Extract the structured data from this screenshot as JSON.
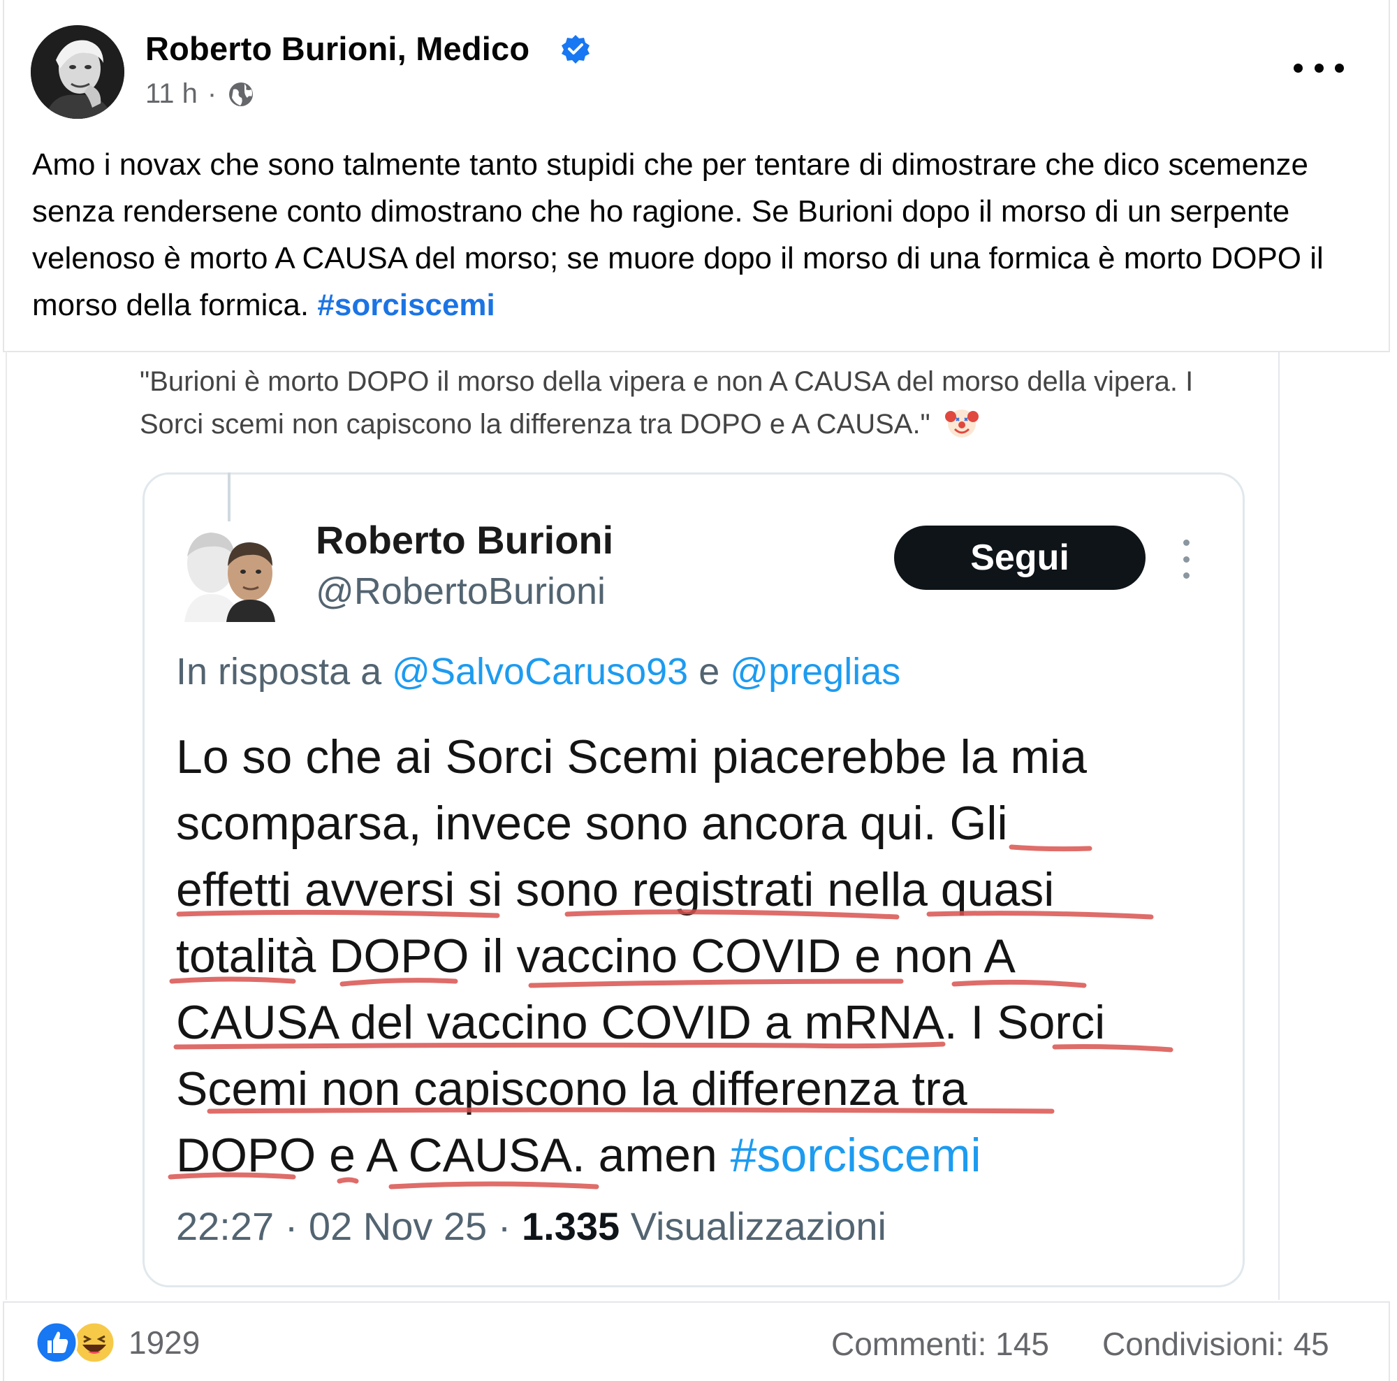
{
  "post": {
    "author": "Roberto Burioni, Medico",
    "time": "11 h",
    "separator": "·",
    "text": "Amo i novax che sono talmente tanto stupidi che per tentare di dimostrare che dico scemenze senza rendersene conto dimostrano che ho ragione. Se Burioni dopo il morso di un serpente velenoso è morto A CAUSA del morso; se muore dopo il morso di una formica è morto DOPO il morso della formica.",
    "hashtag": "#sorciscemi",
    "accent_color": "#1b74e4"
  },
  "image": {
    "caption": "\"Burioni è morto DOPO il morso della vipera e non A CAUSA del morso della vipera. I Sorci scemi non capiscono la differenza tra DOPO e A CAUSA.\"",
    "caption_icon": "clown-face-icon",
    "tweet": {
      "name": "Roberto Burioni",
      "handle": "@RobertoBurioni",
      "follow_label": "Segui",
      "reply_prefix": "In risposta a",
      "reply_mention_1": "@SalvoCaruso93",
      "reply_and": "e",
      "reply_mention_2": "@preglias",
      "body_lines": [
        "Lo so che ai Sorci Scemi piacerebbe la mia",
        "scomparsa, invece sono ancora qui. Gli",
        "effetti avversi si sono registrati nella quasi",
        "totalità DOPO il vaccino COVID e non A",
        "CAUSA del vaccino COVID a mRNA. I Sorci",
        "Scemi non capiscono la differenza tra",
        "DOPO e A CAUSA. amen"
      ],
      "body_hashtag": "#sorciscemi",
      "time": "22:27",
      "date": "02 Nov 25",
      "views_count": "1.335",
      "views_label": "Visualizzazioni",
      "underline_color": "#d9534f"
    }
  },
  "footer": {
    "reactions": [
      "like-icon",
      "haha-icon"
    ],
    "reaction_count": "1929",
    "comments": "Commenti: 145",
    "shares": "Condivisioni: 45"
  }
}
